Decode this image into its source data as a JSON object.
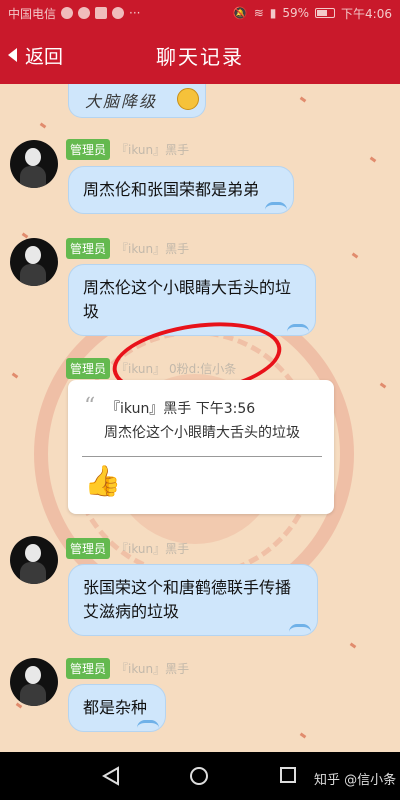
{
  "status": {
    "carrier": "中国电信",
    "battery": "59%",
    "time": "下午4:06"
  },
  "header": {
    "back_label": "返回",
    "title": "聊天记录"
  },
  "top_partial": {
    "text": "大脑降级"
  },
  "messages": [
    {
      "role": "管理员",
      "name": "『ikun』黑手",
      "text": "周杰伦和张国荣都是弟弟"
    },
    {
      "role": "管理员",
      "name": "『ikun』黑手",
      "text": "周杰伦这个小眼睛大舌头的垃圾"
    },
    {
      "role": "管理员",
      "name": "『ikun』 0粉d:信小条"
    },
    {
      "role": "管理员",
      "name": "『ikun』黑手",
      "text": "张国荣这个和唐鹤德联手传播艾滋病的垃圾"
    },
    {
      "role": "管理员",
      "name": "『ikun』黑手",
      "text": "都是杂种"
    }
  ],
  "quote": {
    "head": "『ikun』黑手 下午3:56",
    "text": "周杰伦这个小眼睛大舌头的垃圾",
    "reaction": "👍"
  },
  "watermark": "知乎 @信小条"
}
